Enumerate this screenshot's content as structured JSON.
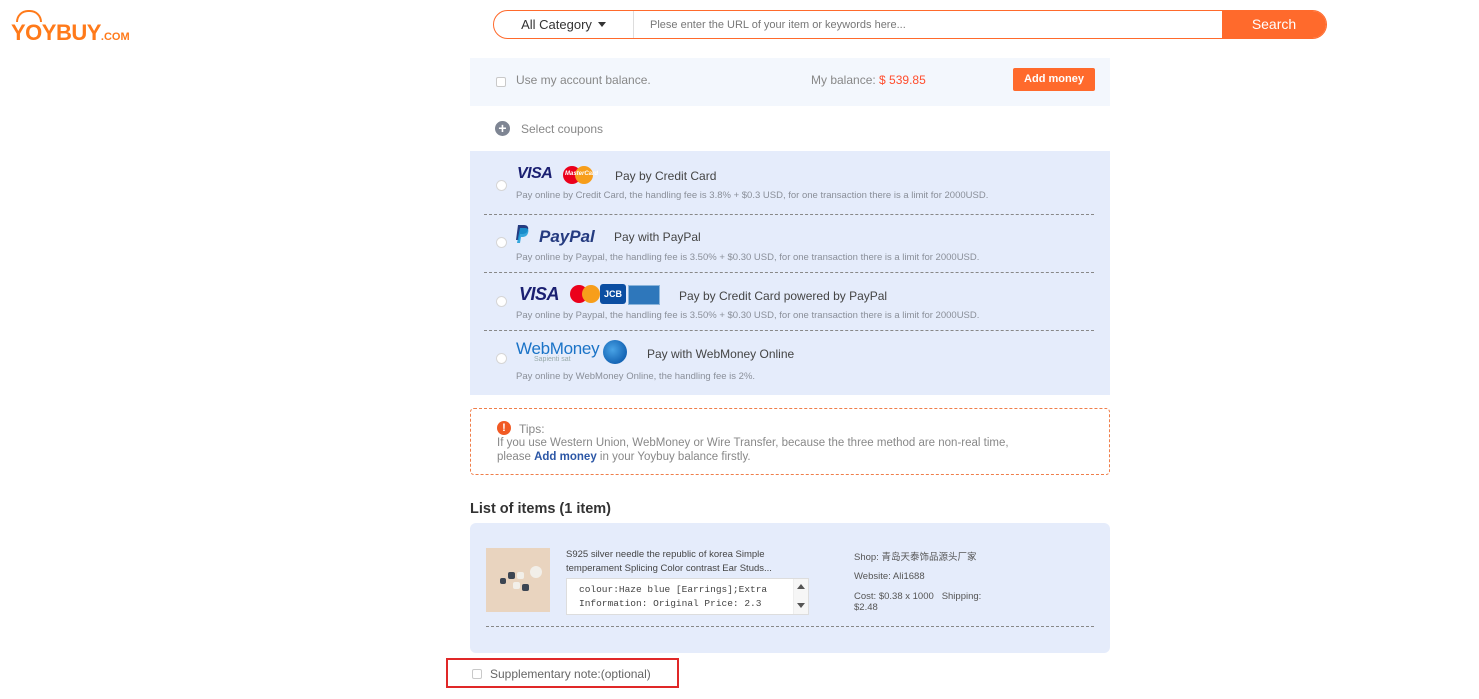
{
  "logo": {
    "brand": "YOYBUY",
    "suffix": ".COM"
  },
  "search": {
    "category": "All Category",
    "placeholder": "Plese enter the URL of your item or keywords here...",
    "button": "Search"
  },
  "balance": {
    "use_label": "Use my account balance.",
    "my_balance_label": "My balance:",
    "amount": "$ 539.85",
    "add_money": "Add money"
  },
  "coupons": {
    "label": "Select coupons"
  },
  "payments": [
    {
      "title": "Pay by Credit Card",
      "desc": "Pay online by Credit Card, the handling fee is 3.8% + $0.3 USD, for one transaction there is a limit for 2000USD.",
      "logos": [
        "VISA",
        "MasterCard"
      ]
    },
    {
      "title": "Pay with PayPal",
      "desc": "Pay online by Paypal, the handling fee is 3.50% + $0.30 USD, for one transaction there is a limit for 2000USD.",
      "logos": [
        "PayPal"
      ]
    },
    {
      "title": "Pay by Credit Card powered by PayPal",
      "desc": "Pay online by Paypal, the handling fee is 3.50% + $0.30 USD, for one transaction there is a limit for 2000USD.",
      "logos": [
        "VISA",
        "JCB"
      ]
    },
    {
      "title": "Pay with WebMoney Online",
      "desc": "Pay online by WebMoney Online, the handling fee is 2%.",
      "logos": [
        "WebMoney",
        "Sapienti sat"
      ]
    }
  ],
  "tips": {
    "title": "Tips:",
    "line1": "If you use Western Union, WebMoney or Wire Transfer, because the three method are non-real time,",
    "line2_pre": "please",
    "line2_link": "Add money",
    "line2_post": "in your Yoybuy balance firstly."
  },
  "items": {
    "heading": "List of items (1 item)",
    "list": [
      {
        "name_line1": "S925 silver needle the republic of korea Simple",
        "name_line2": "temperament Splicing Color contrast Ear Studs...",
        "attr_line1": "colour:Haze blue [Earrings];Extra",
        "attr_line2": "Information: Original Price: 2.3",
        "shop_label": "Shop:",
        "shop": "青岛天泰饰品源头厂家",
        "website_label": "Website:",
        "website": "Ali1688",
        "cost_label": "Cost:",
        "cost": "$0.38 x 1000",
        "shipping_label": "Shipping:",
        "shipping": "$2.48"
      }
    ]
  },
  "note": {
    "label": "Supplementary note:(optional)"
  },
  "colors": {
    "accent": "#ff6a2c",
    "panel": "#e5ecfb",
    "highlight_box": "#e02828",
    "price": "#ff4d2d"
  }
}
